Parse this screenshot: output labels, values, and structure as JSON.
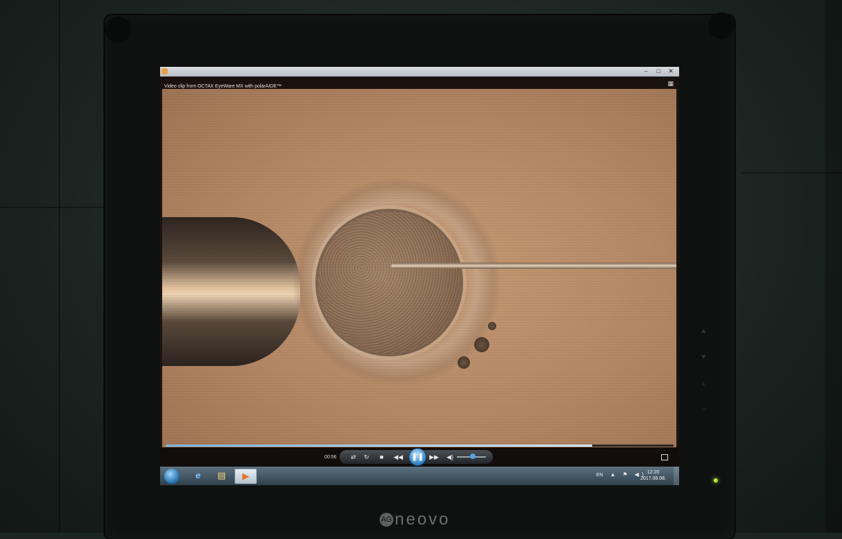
{
  "window": {
    "caption": "Video clip from OCTAX EyeWare MX with polarAIDE™",
    "buttons": [
      "–",
      "□",
      "✕"
    ]
  },
  "player": {
    "elapsed": "00:56",
    "progress_fraction": 0.84,
    "volume_fraction": 0.45,
    "controls": {
      "shuffle": "⇄",
      "repeat": "↻",
      "stop": "■",
      "previous": "◀◀",
      "play_pause": "❚❚",
      "next": "▶▶",
      "volume": "◀)"
    }
  },
  "taskbar": {
    "lang": "EN",
    "tray_icons": "▲ ⚑ ◀)",
    "time": "12:20",
    "date": "2017.06.08.",
    "items": [
      {
        "name": "internet-explorer",
        "glyph": "e"
      },
      {
        "name": "file-explorer",
        "glyph": "▤"
      },
      {
        "name": "media-player",
        "glyph": "▶"
      }
    ]
  },
  "monitor": {
    "brand_badge": "AG",
    "brand": "neovo"
  },
  "colors": {
    "accent": "#4da3e0",
    "video_bg": "#b48865"
  },
  "icons": {
    "layout": "layout-switch-icon",
    "fullscreen": "fullscreen-icon",
    "start": "windows-start-icon"
  }
}
